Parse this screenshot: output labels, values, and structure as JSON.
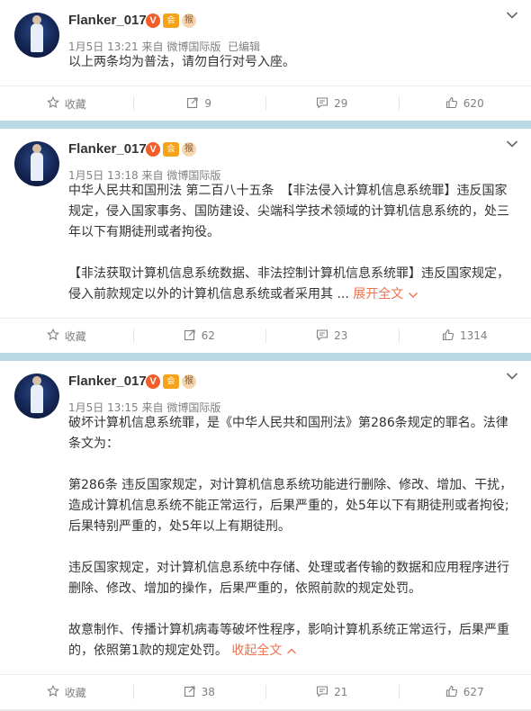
{
  "posts": [
    {
      "author": "Flanker_017",
      "badges": {
        "v": "V",
        "vip": "会",
        "emoji": "猴"
      },
      "date": "1月5日 13:21",
      "source": "来自 微博国际版",
      "edited": "已编辑",
      "paragraphs": [
        "以上两条均为普法，请勿自行对号入座。"
      ],
      "more_label": "",
      "actions": {
        "favorite": "收藏",
        "repost": "9",
        "comment": "29",
        "like": "620"
      }
    },
    {
      "author": "Flanker_017",
      "badges": {
        "v": "V",
        "vip": "会",
        "emoji": "猴"
      },
      "date": "1月5日 13:18",
      "source": "来自 微博国际版",
      "edited": "",
      "paragraphs": [
        "中华人民共和国刑法 第二百八十五条　【非法侵入计算机信息系统罪】违反国家规定，侵入国家事务、国防建设、尖端科学技术领域的计算机信息系统的，处三年以下有期徒刑或者拘役。",
        "【非法获取计算机信息系统数据、非法控制计算机信息系统罪】违反国家规定，侵入前款规定以外的计算机信息系统或者采用其 ..."
      ],
      "more_label": "展开全文",
      "actions": {
        "favorite": "收藏",
        "repost": "62",
        "comment": "23",
        "like": "1314"
      }
    },
    {
      "author": "Flanker_017",
      "badges": {
        "v": "V",
        "vip": "会",
        "emoji": "猴"
      },
      "date": "1月5日 13:15",
      "source": "来自 微博国际版",
      "edited": "",
      "paragraphs": [
        "破坏计算机信息系统罪，是《中华人民共和国刑法》第286条规定的罪名。法律条文为：",
        "第286条 违反国家规定，对计算机信息系统功能进行删除、修改、增加、干扰，造成计算机信息系统不能正常运行，后果严重的，处5年以下有期徒刑或者拘役;后果特别严重的，处5年以上有期徒刑。",
        "违反国家规定，对计算机信息系统中存储、处理或者传输的数据和应用程序进行删除、修改、增加的操作，后果严重的，依照前款的规定处罚。",
        "故意制作、传播计算机病毒等破坏性程序，影响计算机系统正常运行，后果严重的，依照第1款的规定处罚。"
      ],
      "more_label": "收起全文",
      "actions": {
        "favorite": "收藏",
        "repost": "38",
        "comment": "21",
        "like": "627"
      }
    }
  ]
}
